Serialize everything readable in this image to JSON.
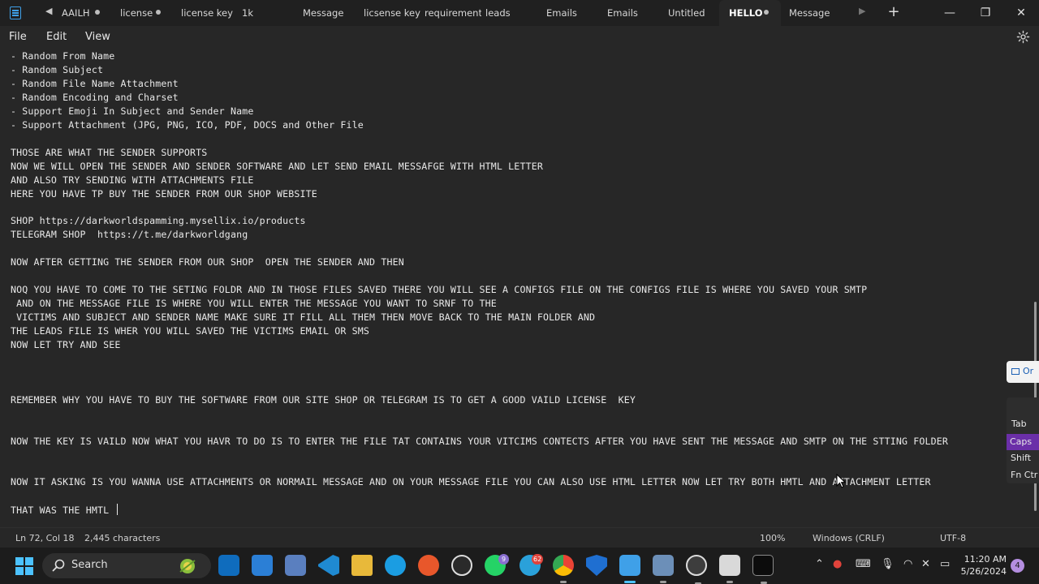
{
  "tabs": {
    "scroll_left": "◀",
    "scroll_right": "▶",
    "items": [
      {
        "label": "AAILH"
      },
      {
        "label": "license"
      },
      {
        "label": "license key"
      },
      {
        "label": "1k"
      },
      {
        "label": "Message"
      },
      {
        "label": "licsense key"
      },
      {
        "label": "requirement"
      },
      {
        "label": "leads"
      },
      {
        "label": "Emails"
      },
      {
        "label": "Emails"
      },
      {
        "label": "Untitled"
      },
      {
        "label": "HELLO"
      },
      {
        "label": "Message"
      }
    ],
    "add": "+"
  },
  "window": {
    "minimize": "—",
    "maximize": "❐",
    "close": "✕"
  },
  "menu": {
    "file": "File",
    "edit": "Edit",
    "view": "View"
  },
  "editor": {
    "lines": [
      "- Random From Name",
      "- Random Subject",
      "- Random File Name Attachment",
      "- Random Encoding and Charset",
      "- Support Emoji In Subject and Sender Name",
      "- Support Attachment (JPG, PNG, ICO, PDF, DOCS and Other File",
      "",
      "THOSE ARE WHAT THE SENDER SUPPORTS",
      "NOW WE WILL OPEN THE SENDER AND SENDER SOFTWARE AND LET SEND EMAIL MESSAFGE WITH HTML LETTER",
      "AND ALSO TRY SENDING WITH ATTACHMENTS FILE",
      "HERE YOU HAVE TP BUY THE SENDER FROM OUR SHOP WEBSITE",
      "",
      "SHOP https://darkworldspamming.mysellix.io/products",
      "TELEGRAM SHOP  https://t.me/darkworldgang",
      "",
      "NOW AFTER GETTING THE SENDER FROM OUR SHOP  OPEN THE SENDER AND THEN",
      "",
      "NOQ YOU HAVE TO COME TO THE SETING FOLDR AND IN THOSE FILES SAVED THERE YOU WILL SEE A CONFIGS FILE ON THE CONFIGS FILE IS WHERE YOU SAVED YOUR SMTP",
      " AND ON THE MESSAGE FILE IS WHERE YOU WILL ENTER THE MESSAGE YOU WANT TO SRNF TO THE",
      " VICTIMS AND SUBJECT AND SENDER NAME MAKE SURE IT FILL ALL THEM THEN MOVE BACK TO THE MAIN FOLDER AND",
      "THE LEADS FILE IS WHER YOU WILL SAVED THE VICTIMS EMAIL OR SMS",
      "NOW LET TRY AND SEE",
      "",
      "",
      "",
      "REMEMBER WHY YOU HAVE TO BUY THE SOFTWARE FROM OUR SITE SHOP OR TELEGRAM IS TO GET A GOOD VAILD LICENSE  KEY",
      "",
      "",
      "NOW THE KEY IS VAILD NOW WHAT YOU HAVR TO DO IS TO ENTER THE FILE TAT CONTAINS YOUR VITCIMS CONTECTS AFTER YOU HAVE SENT THE MESSAGE AND SMTP ON THE STTING FOLDER",
      "",
      "",
      "NOW IT ASKING IS YOU WANNA USE ATTACHMENTS OR NORMAIL MESSAGE AND ON YOUR MESSAGE FILE YOU CAN ALSO USE HTML LETTER NOW LET TRY BOTH HMTL AND ATTACHMENT LETTER",
      "",
      "THAT WAS THE HMTL "
    ]
  },
  "status": {
    "position": "Ln 72, Col 18",
    "characters": "2,445 characters",
    "zoom": "100%",
    "line_ending": "Windows (CRLF)",
    "encoding": "UTF-8"
  },
  "side_popup": {
    "top_text": "Or",
    "keys": [
      "Tab",
      "Caps",
      "Shift",
      "Fn  Ctr"
    ]
  },
  "taskbar": {
    "search_label": "Search",
    "badges": {
      "whatsapp": "9",
      "telegram": "62"
    },
    "time": "11:20 AM",
    "date": "5/26/2024",
    "notifications": "4"
  },
  "colors": {
    "accent": "#4cc2ff",
    "caps_key": "#6b2fa8",
    "background": "#272727"
  }
}
